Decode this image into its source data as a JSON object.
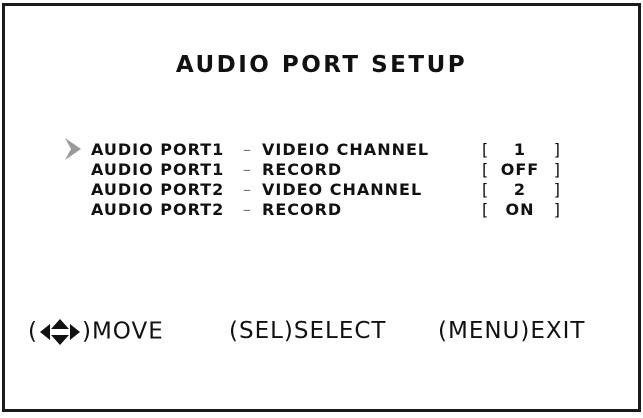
{
  "screen": {
    "title": "AUDIO PORT SETUP"
  },
  "menu": {
    "items": [
      {
        "port": "AUDIO PORT1",
        "separator": "–",
        "param": "VIDEIO CHANNEL",
        "value": "1",
        "selected": true
      },
      {
        "port": "AUDIO PORT1",
        "separator": "–",
        "param": "RECORD",
        "value": "OFF",
        "selected": false
      },
      {
        "port": "AUDIO PORT2",
        "separator": "–",
        "param": "VIDEO CHANNEL",
        "value": "2",
        "selected": false
      },
      {
        "port": "AUDIO PORT2",
        "separator": "–",
        "param": "RECORD",
        "value": "ON",
        "selected": false
      }
    ],
    "bracket_open": "[",
    "bracket_close": "]"
  },
  "footer": {
    "move_open": "(",
    "move_label": ")MOVE",
    "select_label": "(SEL)SELECT",
    "exit_label": "(MENU)EXIT"
  },
  "icons": {
    "cursor": "triangle-right-icon",
    "nav": "four-direction-arrows-icon"
  },
  "colors": {
    "background": "#ffffff",
    "text": "#111111",
    "cursor": "#999999",
    "border": "#1a1a1a"
  }
}
